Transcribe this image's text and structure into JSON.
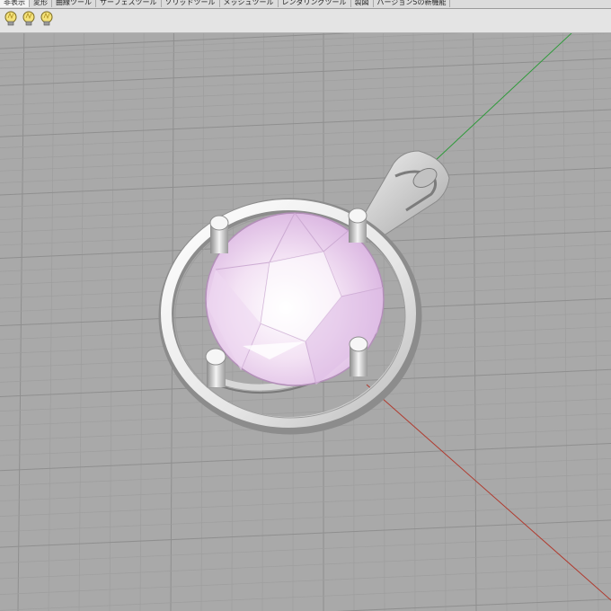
{
  "tabs": [
    {
      "label": "非表示",
      "active": true
    },
    {
      "label": "変形",
      "active": false
    },
    {
      "label": "曲線ツール",
      "active": false
    },
    {
      "label": "サーフェスツール",
      "active": false
    },
    {
      "label": "ソリッドツール",
      "active": false
    },
    {
      "label": "メッシュツール",
      "active": false
    },
    {
      "label": "レンダリングツール",
      "active": false
    },
    {
      "label": "製図",
      "active": false
    },
    {
      "label": "バージョン5の新機能",
      "active": false
    }
  ],
  "toolbar": {
    "buttons": [
      {
        "name": "light-bulb-icon-1"
      },
      {
        "name": "light-bulb-icon-2"
      },
      {
        "name": "light-bulb-icon-3"
      }
    ]
  },
  "viewport": {
    "background": "#a9a9a9",
    "grid_minor_color": "#9e9e9e",
    "grid_major_color": "#8f8f8f",
    "x_axis_color": "#b03a2e",
    "y_axis_color": "#2e9a3a",
    "gem_color": "#eecff0",
    "metal_color": "#ececec"
  }
}
